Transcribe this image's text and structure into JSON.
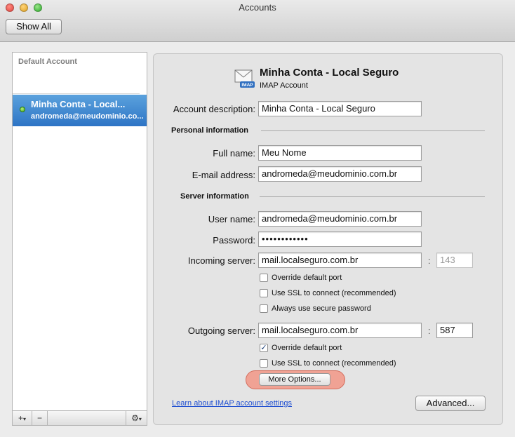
{
  "window": {
    "title": "Accounts"
  },
  "toolbar": {
    "show_all_label": "Show All"
  },
  "sidebar": {
    "default_section_label": "Default Account",
    "accounts": [
      {
        "name": "Minha Conta - Local...",
        "email": "andromeda@meudominio.co...",
        "status": "online",
        "selected": true
      }
    ],
    "bottom_bar": {
      "add_label": "+",
      "add_menu_glyph": "▾",
      "remove_label": "−",
      "gear_glyph": "⚙",
      "gear_menu_glyph": "▾"
    }
  },
  "detail": {
    "account_title": "Minha Conta - Local Seguro",
    "account_type": "IMAP Account",
    "icon_badge": "IMAP",
    "account_description": {
      "label": "Account description:",
      "value": "Minha Conta - Local Seguro"
    },
    "personal_section": "Personal information",
    "full_name": {
      "label": "Full name:",
      "value": "Meu Nome"
    },
    "email_address": {
      "label": "E-mail address:",
      "value": "andromeda@meudominio.com.br"
    },
    "server_section": "Server information",
    "user_name": {
      "label": "User name:",
      "value": "andromeda@meudominio.com.br"
    },
    "password": {
      "label": "Password:",
      "value": "••••••••••••"
    },
    "incoming_server": {
      "label": "Incoming server:",
      "value": "mail.localseguro.com.br",
      "separator": ":",
      "port": "143"
    },
    "incoming_options": [
      {
        "label": "Override default port",
        "checked": false
      },
      {
        "label": "Use SSL to connect (recommended)",
        "checked": false
      },
      {
        "label": "Always use secure password",
        "checked": false
      }
    ],
    "outgoing_server": {
      "label": "Outgoing server:",
      "value": "mail.localseguro.com.br",
      "separator": ":",
      "port": "587"
    },
    "outgoing_options": [
      {
        "label": "Override default port",
        "checked": true
      },
      {
        "label": "Use SSL to connect (recommended)",
        "checked": false
      }
    ],
    "more_options_label": "More Options...",
    "learn_link": "Learn about IMAP account settings",
    "advanced_label": "Advanced...",
    "checkmark_glyph": "✓"
  },
  "colors": {
    "selection_top": "#5ba2dd",
    "selection_bottom": "#2e74c5",
    "highlight": "#f0a294",
    "link": "#1f4fd1"
  }
}
